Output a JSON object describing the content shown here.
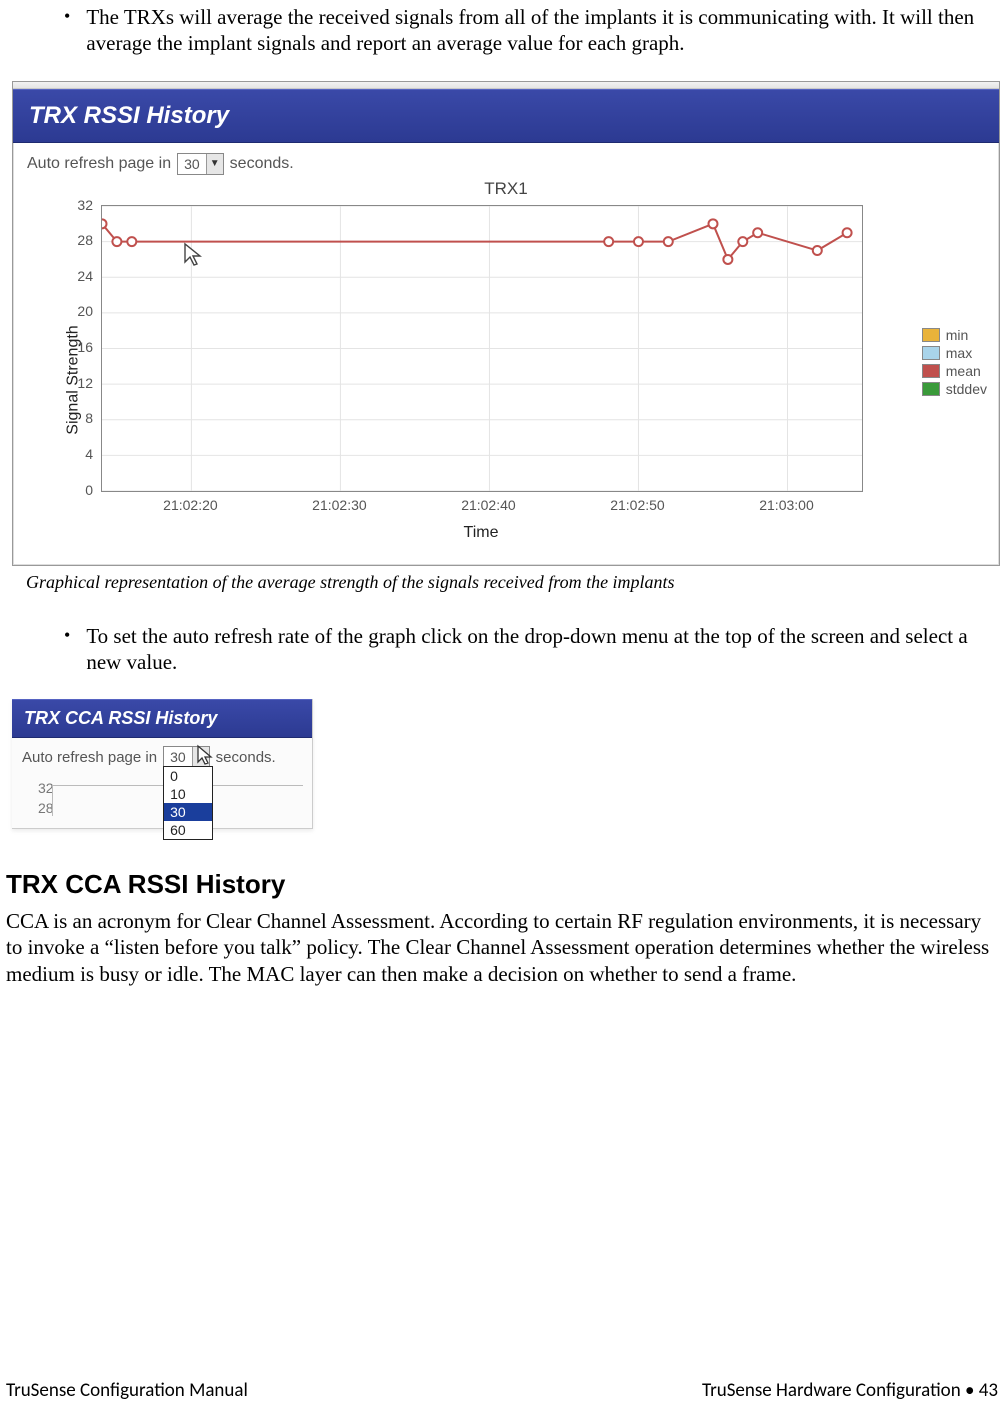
{
  "bullets": {
    "b1": "The TRXs will average the received signals from all of the implants it is communicating with.  It will then average the implant signals and report an average value for each graph.",
    "b2": "To set the auto refresh rate of the graph click on the drop-down menu at the top of the screen and select a new value."
  },
  "fig1": {
    "banner": "TRX RSSI History",
    "refresh_prefix": "Auto refresh page in",
    "refresh_value": "30",
    "refresh_suffix": "seconds."
  },
  "fig2": {
    "banner": "TRX CCA RSSI History",
    "refresh_prefix": "Auto refresh page in",
    "refresh_value": "30",
    "refresh_suffix": "seconds.",
    "options": [
      "0",
      "10",
      "30",
      "60"
    ],
    "selected": "30",
    "ytick_a": "32",
    "ytick_b": "28"
  },
  "caption1": "Graphical representation of the average strength of the signals received from the implants",
  "section_heading": "TRX CCA RSSI History",
  "section_body": "CCA is an acronym for Clear Channel Assessment.  According to certain RF regulation environments, it is necessary to invoke a “listen before you talk” policy.  The Clear Channel Assessment operation determines whether the wireless medium is busy or idle.  The MAC layer can then make a decision on whether to send a frame.",
  "footer": {
    "left": "TruSense Configuration Manual",
    "right": "TruSense Hardware Configuration  •  43"
  },
  "chart_data": {
    "type": "line",
    "title": "TRX1",
    "xlabel": "Time",
    "ylabel": "Signal Strength",
    "ylim": [
      0,
      32
    ],
    "y_ticks": [
      0,
      4,
      8,
      12,
      16,
      20,
      24,
      28,
      32
    ],
    "x_ticks": [
      "21:02:20",
      "21:02:30",
      "21:02:40",
      "21:02:50",
      "21:03:00"
    ],
    "legend": [
      {
        "name": "min",
        "color": "#e9b33a"
      },
      {
        "name": "max",
        "color": "#a9d4ea"
      },
      {
        "name": "mean",
        "color": "#c0504d"
      },
      {
        "name": "stddev",
        "color": "#3a9a3a"
      }
    ],
    "series": [
      {
        "name": "mean",
        "color": "#c0504d",
        "points": [
          {
            "x": "21:02:14",
            "y": 30
          },
          {
            "x": "21:02:15",
            "y": 28
          },
          {
            "x": "21:02:16",
            "y": 28
          },
          {
            "x": "21:02:48",
            "y": 28
          },
          {
            "x": "21:02:50",
            "y": 28
          },
          {
            "x": "21:02:52",
            "y": 28
          },
          {
            "x": "21:02:55",
            "y": 30
          },
          {
            "x": "21:02:56",
            "y": 26
          },
          {
            "x": "21:02:57",
            "y": 28
          },
          {
            "x": "21:02:58",
            "y": 29
          },
          {
            "x": "21:03:02",
            "y": 27
          },
          {
            "x": "21:03:04",
            "y": 29
          }
        ]
      }
    ]
  }
}
